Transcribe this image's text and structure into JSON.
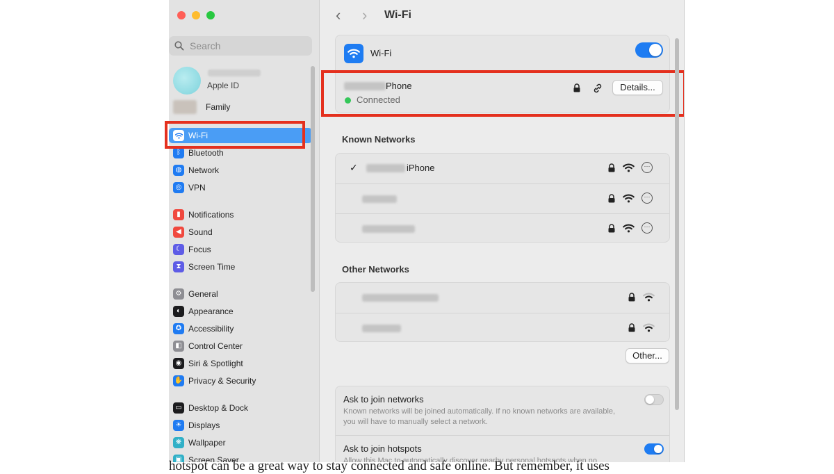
{
  "window": {
    "title": "Wi-Fi"
  },
  "sidebar": {
    "search_placeholder": "Search",
    "account_label": "Apple ID",
    "family_label": "Family",
    "items": [
      {
        "label": "Wi-Fi",
        "icon": "wifi-icon",
        "color": "#1f7bf2"
      },
      {
        "label": "Bluetooth",
        "icon": "bluetooth-icon",
        "color": "#1f7bf2"
      },
      {
        "label": "Network",
        "icon": "globe-icon",
        "color": "#1f7bf2"
      },
      {
        "label": "VPN",
        "icon": "vpn-icon",
        "color": "#1f7bf2"
      },
      {
        "label": "Notifications",
        "icon": "bell-icon",
        "color": "#f0483e"
      },
      {
        "label": "Sound",
        "icon": "speaker-icon",
        "color": "#f0483e"
      },
      {
        "label": "Focus",
        "icon": "moon-icon",
        "color": "#5e5ce6"
      },
      {
        "label": "Screen Time",
        "icon": "hourglass-icon",
        "color": "#5e5ce6"
      },
      {
        "label": "General",
        "icon": "gear-icon",
        "color": "#8e8e93"
      },
      {
        "label": "Appearance",
        "icon": "appearance-icon",
        "color": "#1c1c1e"
      },
      {
        "label": "Accessibility",
        "icon": "accessibility-icon",
        "color": "#1f7bf2"
      },
      {
        "label": "Control Center",
        "icon": "control-center-icon",
        "color": "#8e8e93"
      },
      {
        "label": "Siri & Spotlight",
        "icon": "siri-icon",
        "color": "#1c1c1e"
      },
      {
        "label": "Privacy & Security",
        "icon": "hand-icon",
        "color": "#1f7bf2"
      },
      {
        "label": "Desktop & Dock",
        "icon": "dock-icon",
        "color": "#1c1c1e"
      },
      {
        "label": "Displays",
        "icon": "sun-icon",
        "color": "#1f7bf2"
      },
      {
        "label": "Wallpaper",
        "icon": "wallpaper-icon",
        "color": "#30b0c7"
      },
      {
        "label": "Screen Saver",
        "icon": "screensaver-icon",
        "color": "#30b0c7"
      }
    ]
  },
  "wifi": {
    "label": "Wi-Fi",
    "enabled": true,
    "current_network": {
      "name_suffix": "Phone",
      "status": "Connected",
      "details_label": "Details..."
    },
    "known_section": "Known Networks",
    "known_networks": [
      {
        "name_suffix": "iPhone",
        "checked": true
      },
      {
        "name_suffix": "",
        "checked": false
      },
      {
        "name_suffix": "",
        "checked": false
      }
    ],
    "other_section": "Other Networks",
    "other_button": "Other...",
    "ask_networks": {
      "title": "Ask to join networks",
      "description": "Known networks will be joined automatically. If no known networks are available, you will have to manually select a network.",
      "enabled": false
    },
    "ask_hotspots": {
      "title": "Ask to join hotspots",
      "description": "Allow this Mac to automatically discover nearby personal hotspots when no",
      "enabled": true
    }
  },
  "caption": "hotspot can be a great way to stay connected and safe online. But remember, it uses",
  "colors": {
    "accent": "#1e7cf2",
    "highlight": "#e4301e",
    "connected": "#34c759"
  }
}
